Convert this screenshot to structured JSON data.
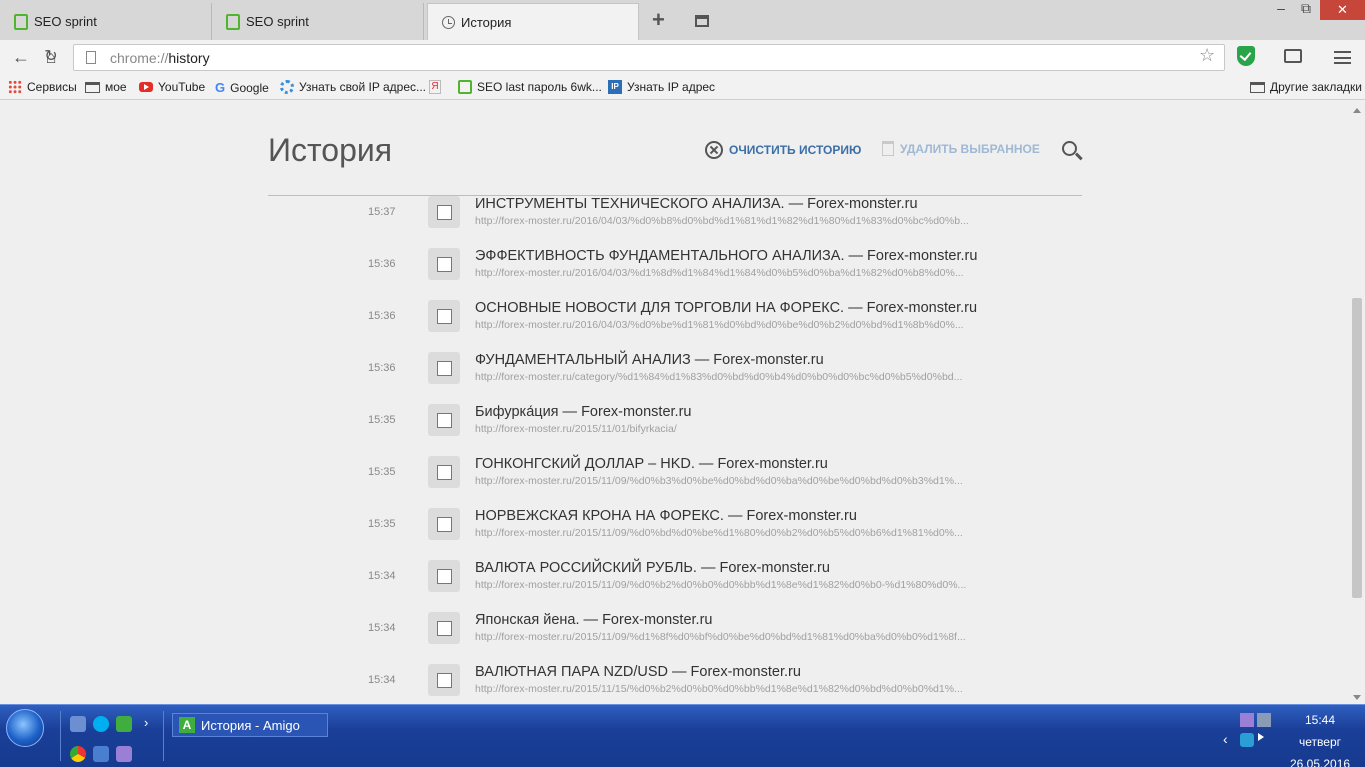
{
  "tabs": [
    {
      "label": "SEO sprint"
    },
    {
      "label": "SEO sprint"
    },
    {
      "label": "История"
    }
  ],
  "window_controls": {
    "minimize": "–",
    "restore": "⧉",
    "close": "✕"
  },
  "omnibox": {
    "scheme": "chrome://",
    "path": "history"
  },
  "bookmarks": [
    {
      "label": "Сервисы",
      "icon": "apps-icon"
    },
    {
      "label": "мое",
      "icon": "folder-icon"
    },
    {
      "label": "YouTube",
      "icon": "youtube-icon"
    },
    {
      "label": "Google",
      "icon": "google-icon"
    },
    {
      "label": "Узнать свой IP адрес...",
      "icon": "gear-icon"
    },
    {
      "label": "",
      "icon": "yandex-icon"
    },
    {
      "label": "SEO last  пароль 6wk...",
      "icon": "seo-icon"
    },
    {
      "label": "Узнать IP адрес",
      "icon": "ip-icon"
    }
  ],
  "other_bookmarks": "Другие закладки",
  "page": {
    "title": "История",
    "clear_label": "ОЧИСТИТЬ ИСТОРИЮ",
    "delete_label": "УДАЛИТЬ ВЫБРАННОЕ"
  },
  "entries": [
    {
      "time": "15:37",
      "title": "ИНСТРУМЕНТЫ ТЕХНИЧЕСКОГО АНАЛИЗА. — Forex-monster.ru",
      "url": "http://forex-moster.ru/2016/04/03/%d0%b8%d0%bd%d1%81%d1%82%d1%80%d1%83%d0%bc%d0%b..."
    },
    {
      "time": "15:36",
      "title": "ЭФФЕКТИВНОСТЬ ФУНДАМЕНТАЛЬНОГО АНАЛИЗА. — Forex-monster.ru",
      "url": "http://forex-moster.ru/2016/04/03/%d1%8d%d1%84%d1%84%d0%b5%d0%ba%d1%82%d0%b8%d0%..."
    },
    {
      "time": "15:36",
      "title": "ОСНОВНЫЕ НОВОСТИ ДЛЯ ТОРГОВЛИ НА ФОРЕКС. — Forex-monster.ru",
      "url": "http://forex-moster.ru/2016/04/03/%d0%be%d1%81%d0%bd%d0%be%d0%b2%d0%bd%d1%8b%d0%..."
    },
    {
      "time": "15:36",
      "title": "ФУНДАМЕНТАЛЬНЫЙ АНАЛИЗ — Forex-monster.ru",
      "url": "http://forex-moster.ru/category/%d1%84%d1%83%d0%bd%d0%b4%d0%b0%d0%bc%d0%b5%d0%bd..."
    },
    {
      "time": "15:35",
      "title": "Бифурка́ция — Forex-monster.ru",
      "url": "http://forex-moster.ru/2015/11/01/bifyrkacia/"
    },
    {
      "time": "15:35",
      "title": "ГОНКОНГСКИЙ ДОЛЛАР – HKD. — Forex-monster.ru",
      "url": "http://forex-moster.ru/2015/11/09/%d0%b3%d0%be%d0%bd%d0%ba%d0%be%d0%bd%d0%b3%d1%..."
    },
    {
      "time": "15:35",
      "title": "НОРВЕЖСКАЯ КРОНА НА ФОРЕКС. — Forex-monster.ru",
      "url": "http://forex-moster.ru/2015/11/09/%d0%bd%d0%be%d1%80%d0%b2%d0%b5%d0%b6%d1%81%d0%..."
    },
    {
      "time": "15:34",
      "title": "ВАЛЮТА РОССИЙСКИЙ РУБЛЬ. — Forex-monster.ru",
      "url": "http://forex-moster.ru/2015/11/09/%d0%b2%d0%b0%d0%bb%d1%8e%d1%82%d0%b0-%d1%80%d0%..."
    },
    {
      "time": "15:34",
      "title": "Японская йена. — Forex-monster.ru",
      "url": "http://forex-moster.ru/2015/11/09/%d1%8f%d0%bf%d0%be%d0%bd%d1%81%d0%ba%d0%b0%d1%8f..."
    },
    {
      "time": "15:34",
      "title": "ВАЛЮТНАЯ ПАРА NZD/USD — Forex-monster.ru",
      "url": "http://forex-moster.ru/2015/11/15/%d0%b2%d0%b0%d0%bb%d1%8e%d1%82%d0%bd%d0%b0%d1%..."
    }
  ],
  "taskbar": {
    "window_label": "История - Amigo",
    "clock_time": "15:44",
    "clock_day": "четверг",
    "clock_date": "26.05.2016",
    "overflow_arrow": "›",
    "tray_arrow": "‹"
  },
  "colors": {
    "accent": "#3b6fa6",
    "taskbar": "#1a3f98",
    "close": "#c7463a"
  }
}
